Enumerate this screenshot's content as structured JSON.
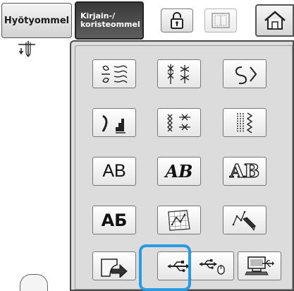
{
  "tabs": {
    "utility_label": "Hyötyommel",
    "character_label_line1": "Kirjain-/",
    "character_label_line2": "koristeommel"
  },
  "icons": {
    "lock": "lock-icon",
    "frame": "frame-icon",
    "home": "home-icon",
    "needle": "needle-icon"
  },
  "grid": {
    "row3": {
      "text_ab": "AB",
      "script_ab": "AB",
      "outline_ab": "AB"
    },
    "row4": {
      "cyrillic": "АБ"
    }
  },
  "colors": {
    "selection": "#2a9be0",
    "panel_bg": "#dcdcdc",
    "active_tab": "#3a3a3a"
  }
}
